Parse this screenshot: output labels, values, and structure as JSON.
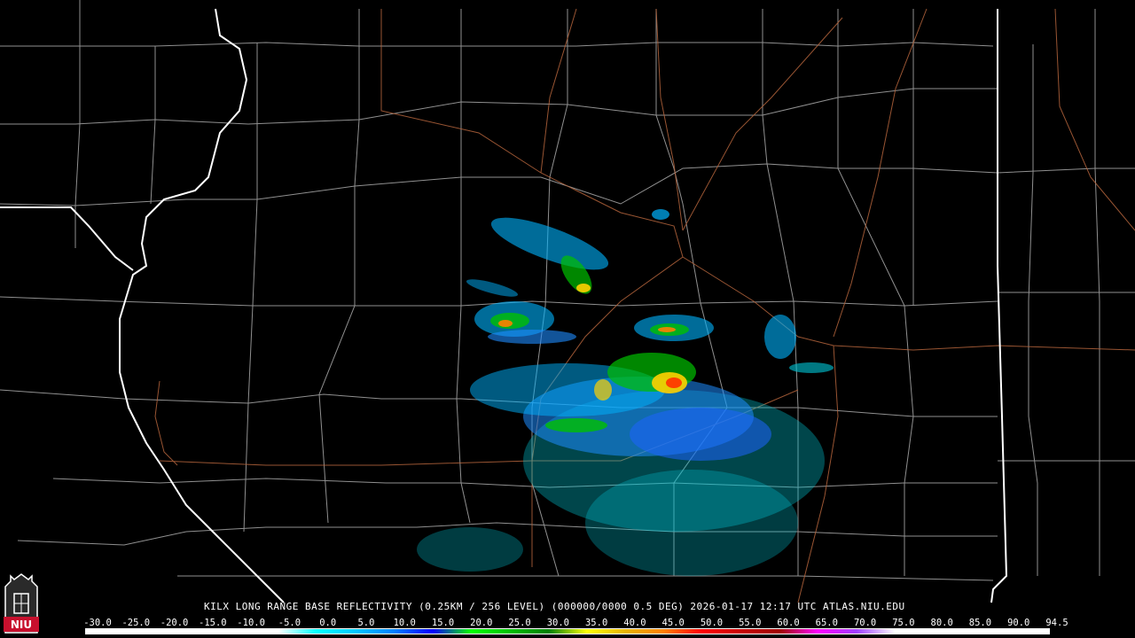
{
  "caption": "KILX LONG RANGE BASE REFLECTIVITY (0.25KM / 256 LEVEL) (000000/0000 0.5 DEG) 2026-01-17 12:17 UTC  ATLAS.NIU.EDU",
  "logo_text": "NIU",
  "scale_labels": [
    "-30.0",
    "-25.0",
    "-20.0",
    "-15.0",
    "-10.0",
    "-5.0",
    "0.0",
    "5.0",
    "10.0",
    "15.0",
    "20.0",
    "25.0",
    "30.0",
    "35.0",
    "40.0",
    "45.0",
    "50.0",
    "55.0",
    "60.0",
    "65.0",
    "70.0",
    "75.0",
    "80.0",
    "85.0",
    "90.0",
    "94.5"
  ],
  "scale_colors": [
    "#ffffff",
    "#ffffff",
    "#ffffff",
    "#ffffff",
    "#ffffff",
    "#ffffff",
    "#00ffff",
    "#00c8ff",
    "#0080ff",
    "#0000ff",
    "#00ff00",
    "#00c000",
    "#008000",
    "#ffff00",
    "#e6b400",
    "#ff8000",
    "#ff0000",
    "#c80000",
    "#a00000",
    "#ff00ff",
    "#a040ff",
    "#ffffff",
    "#ffffff",
    "#ffffff",
    "#ffffff",
    "#ffffff"
  ],
  "colors": {
    "county_lines": "#b4b4b4",
    "state_lines": "#ffffff",
    "highways": "#b4643c",
    "background": "#000000"
  }
}
